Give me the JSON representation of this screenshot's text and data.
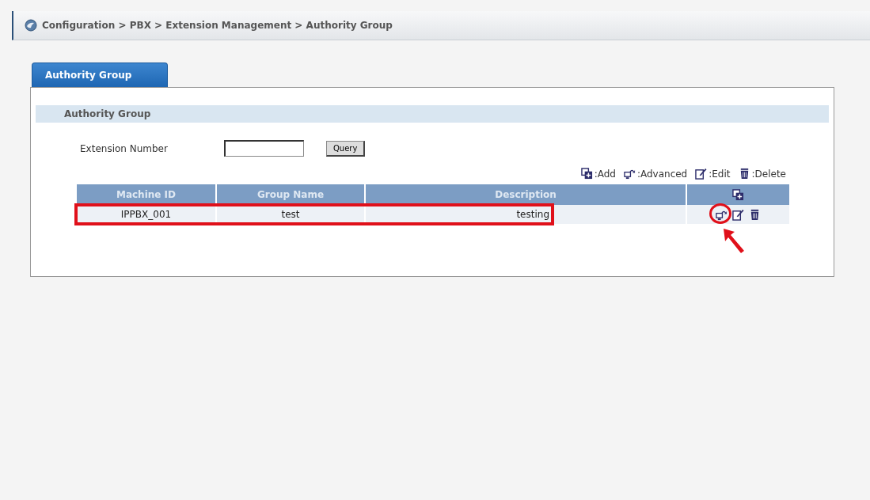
{
  "breadcrumb": "Configuration > PBX > Extension Management > Authority Group",
  "tabs": [
    {
      "label": "Authority Group",
      "selected": true
    }
  ],
  "section_title": "Authority Group",
  "filter": {
    "label": "Extension Number",
    "button": "Query"
  },
  "legend": [
    {
      "kind": "add",
      "label": ":Add"
    },
    {
      "kind": "advanced",
      "label": ":Advanced"
    },
    {
      "kind": "edit",
      "label": ":Edit"
    },
    {
      "kind": "delete",
      "label": ":Delete"
    }
  ],
  "table": {
    "columns": [
      "Machine ID",
      "Group Name",
      "Description"
    ],
    "action_header": {
      "kind": "add"
    },
    "rows": [
      {
        "cells": [
          "IPPBX_001",
          "test",
          "testing"
        ],
        "highlighted": true,
        "actions": [
          {
            "kind": "advanced",
            "circled": true
          },
          {
            "kind": "edit",
            "circled": false
          },
          {
            "kind": "delete",
            "circled": false
          }
        ]
      }
    ]
  },
  "pointer_arrow": true
}
